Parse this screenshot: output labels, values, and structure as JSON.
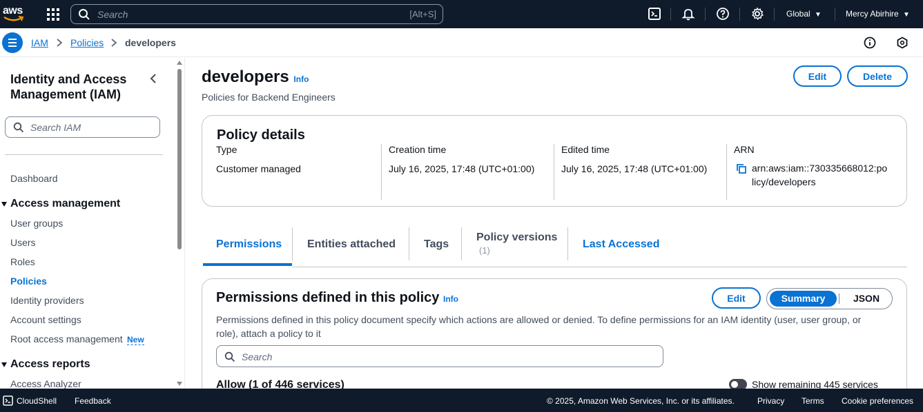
{
  "topbar": {
    "logo_text": "aws",
    "search_placeholder": "Search",
    "search_shortcut": "[Alt+S]",
    "region": "Global",
    "user": "Mercy Abirhire",
    "icons": [
      "apps-grid-icon",
      "cloudshell-icon",
      "bell-icon",
      "help-icon",
      "gear-icon"
    ]
  },
  "breadcrumb": {
    "items": [
      "IAM",
      "Policies",
      "developers"
    ]
  },
  "sidebar": {
    "title": "Identity and Access Management (IAM)",
    "search_placeholder": "Search IAM",
    "dashboard": "Dashboard",
    "section_access_management": "Access management",
    "items": [
      "User groups",
      "Users",
      "Roles",
      "Policies",
      "Identity providers",
      "Account settings",
      "Root access management"
    ],
    "new_badge": "New",
    "section_access_reports": "Access reports",
    "access_analyzer": "Access Analyzer"
  },
  "page": {
    "title": "developers",
    "info": "Info",
    "subtitle": "Policies for Backend Engineers",
    "edit_label": "Edit",
    "delete_label": "Delete"
  },
  "details": {
    "heading": "Policy details",
    "type_label": "Type",
    "type_value": "Customer managed",
    "creation_label": "Creation time",
    "creation_value": "July 16, 2025, 17:48 (UTC+01:00)",
    "edited_label": "Edited time",
    "edited_value": "July 16, 2025, 17:48 (UTC+01:00)",
    "arn_label": "ARN",
    "arn_line1": "arn:aws:iam::730335668012:po",
    "arn_line2": "licy/developers"
  },
  "tabs": {
    "permissions": "Permissions",
    "entities": "Entities attached",
    "tags": "Tags",
    "versions": "Policy versions",
    "versions_count": "(1)",
    "last_accessed": "Last Accessed"
  },
  "permissions": {
    "heading": "Permissions defined in this policy",
    "info": "Info",
    "edit_label": "Edit",
    "summary_label": "Summary",
    "json_label": "JSON",
    "description": "Permissions defined in this policy document specify which actions are allowed or denied. To define permissions for an IAM identity (user, user group, or role), attach a policy to it",
    "search_placeholder": "Search",
    "allow_heading": "Allow (1 of 446 services)",
    "toggle_label": "Show remaining 445 services"
  },
  "footer": {
    "cloudshell": "CloudShell",
    "feedback": "Feedback",
    "copyright": "© 2025, Amazon Web Services, Inc. or its affiliates.",
    "privacy": "Privacy",
    "terms": "Terms",
    "cookies": "Cookie preferences"
  },
  "colors": {
    "accent": "#0972d3",
    "topbar_bg": "#0f1b2a"
  }
}
